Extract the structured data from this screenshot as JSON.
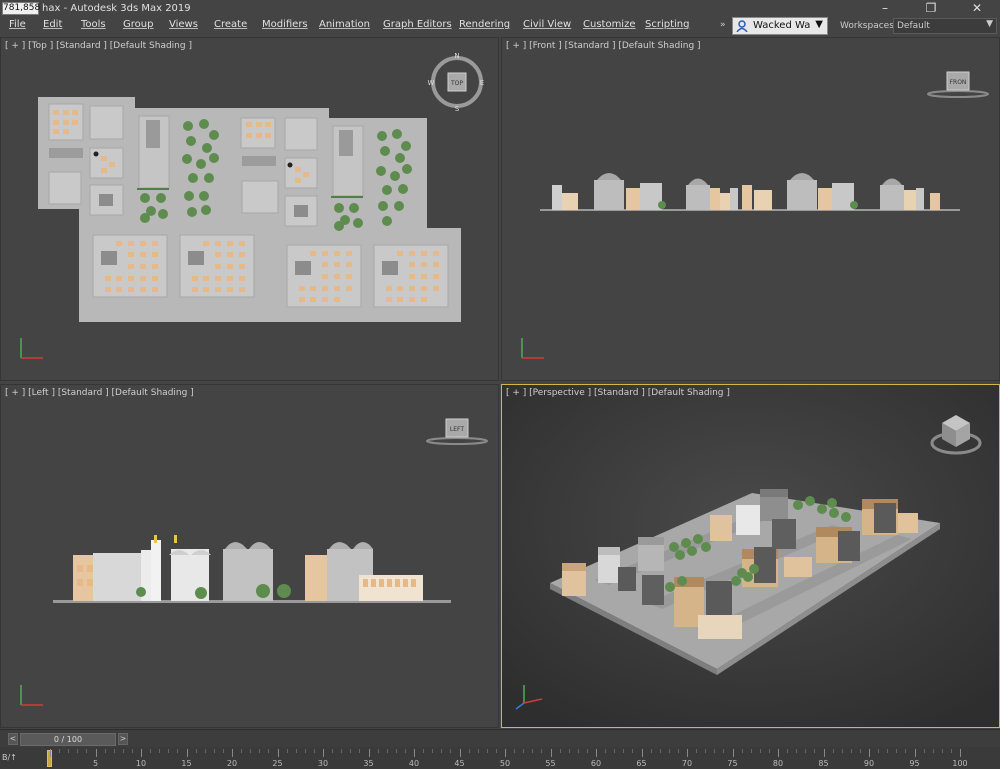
{
  "window": {
    "coord_readout": "781,858",
    "title": "hax - Autodesk 3ds Max 2019",
    "controls": [
      "–",
      "❐",
      "✕"
    ]
  },
  "menu": {
    "items": [
      "File",
      "Edit",
      "Tools",
      "Group",
      "Views",
      "Create",
      "Modifiers",
      "Animation",
      "Graph Editors",
      "Rendering",
      "Civil View",
      "Customize",
      "Scripting"
    ],
    "more": "»"
  },
  "user": {
    "name": "Wacked Wa",
    "caret": "▼"
  },
  "workspace": {
    "label": "Workspaces:",
    "value": "Default",
    "caret": "▼"
  },
  "viewports": {
    "top": {
      "label": "[ + ] [Top ] [Standard ] [Default Shading ]",
      "viewcube": {
        "label": "TOP",
        "n": "N",
        "s": "S",
        "e": "E",
        "w": "W"
      }
    },
    "front": {
      "label": "[ + ] [Front ] [Standard ] [Default Shading ]",
      "viewcube": {
        "label": "FRON"
      }
    },
    "left": {
      "label": "[ + ] [Left ] [Standard ] [Default Shading ]",
      "viewcube": {
        "label": "LEFT"
      }
    },
    "perspective": {
      "label": "[ + ] [Perspective ] [Standard ] [Default Shading ]",
      "active": true
    }
  },
  "timeline": {
    "frame_display": "0 / 100",
    "prev": "<",
    "next": ">",
    "ticks": [
      "0",
      "5",
      "10",
      "15",
      "20",
      "25",
      "30",
      "35",
      "40",
      "45",
      "50",
      "55",
      "60",
      "65",
      "70",
      "75",
      "80",
      "85",
      "90",
      "95",
      "100"
    ],
    "corner": "B/↑"
  },
  "colors": {
    "background": "#444444",
    "active_border": "#d7b44a",
    "ground": "#b8b8b8",
    "building_roof": "#c8c8c8",
    "warm": "#e6b98a",
    "tree": "#5e8c4f"
  }
}
